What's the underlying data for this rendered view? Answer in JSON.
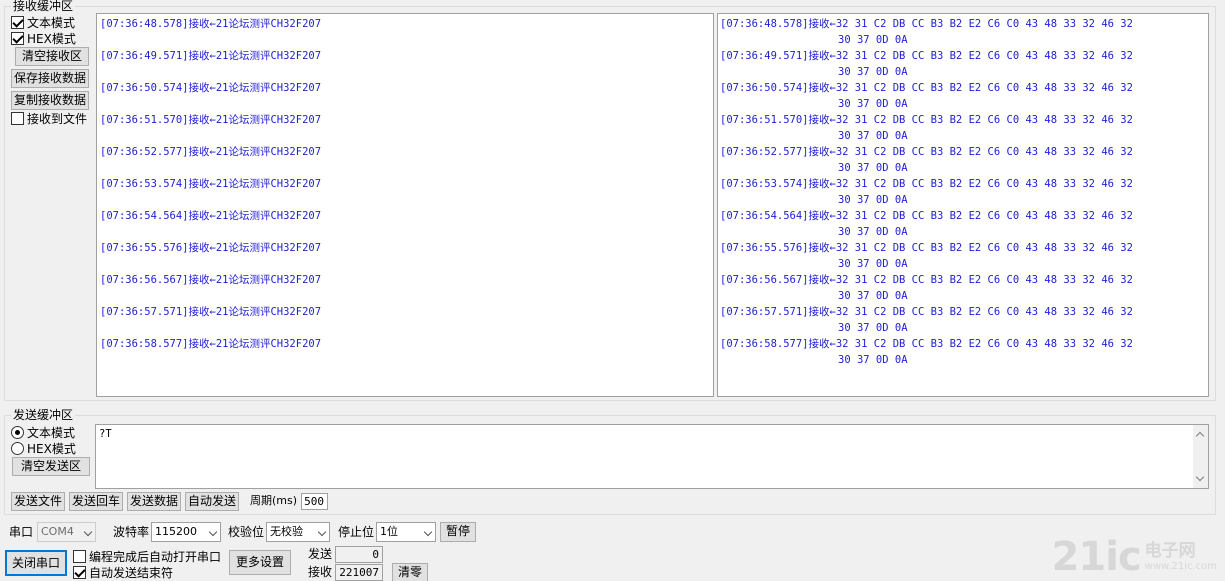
{
  "receive": {
    "group_title": "接收缓冲区",
    "text_mode_label": "文本模式",
    "text_mode_checked": true,
    "hex_mode_label": "HEX模式",
    "hex_mode_checked": true,
    "clear_button": "清空接收区",
    "save_button": "保存接收数据",
    "copy_button": "复制接收数据",
    "to_file_label": "接收到文件",
    "to_file_checked": false,
    "text_lines": [
      "[07:36:48.578]接收←21论坛测评CH32F207",
      "[07:36:49.571]接收←21论坛测评CH32F207",
      "[07:36:50.574]接收←21论坛测评CH32F207",
      "[07:36:51.570]接收←21论坛测评CH32F207",
      "[07:36:52.577]接收←21论坛测评CH32F207",
      "[07:36:53.574]接收←21论坛测评CH32F207",
      "[07:36:54.564]接收←21论坛测评CH32F207",
      "[07:36:55.576]接收←21论坛测评CH32F207",
      "[07:36:56.567]接收←21论坛测评CH32F207",
      "[07:36:57.571]接收←21论坛测评CH32F207",
      "[07:36:58.577]接收←21论坛测评CH32F207"
    ],
    "hex_lines": [
      {
        "line1": "[07:36:48.578]接收←32 31 C2 DB CC B3 B2 E2 C6 C0 43 48 33 32 46 32",
        "line2": "30 37 0D 0A"
      },
      {
        "line1": "[07:36:49.571]接收←32 31 C2 DB CC B3 B2 E2 C6 C0 43 48 33 32 46 32",
        "line2": "30 37 0D 0A"
      },
      {
        "line1": "[07:36:50.574]接收←32 31 C2 DB CC B3 B2 E2 C6 C0 43 48 33 32 46 32",
        "line2": "30 37 0D 0A"
      },
      {
        "line1": "[07:36:51.570]接收←32 31 C2 DB CC B3 B2 E2 C6 C0 43 48 33 32 46 32",
        "line2": "30 37 0D 0A"
      },
      {
        "line1": "[07:36:52.577]接收←32 31 C2 DB CC B3 B2 E2 C6 C0 43 48 33 32 46 32",
        "line2": "30 37 0D 0A"
      },
      {
        "line1": "[07:36:53.574]接收←32 31 C2 DB CC B3 B2 E2 C6 C0 43 48 33 32 46 32",
        "line2": "30 37 0D 0A"
      },
      {
        "line1": "[07:36:54.564]接收←32 31 C2 DB CC B3 B2 E2 C6 C0 43 48 33 32 46 32",
        "line2": "30 37 0D 0A"
      },
      {
        "line1": "[07:36:55.576]接收←32 31 C2 DB CC B3 B2 E2 C6 C0 43 48 33 32 46 32",
        "line2": "30 37 0D 0A"
      },
      {
        "line1": "[07:36:56.567]接收←32 31 C2 DB CC B3 B2 E2 C6 C0 43 48 33 32 46 32",
        "line2": "30 37 0D 0A"
      },
      {
        "line1": "[07:36:57.571]接收←32 31 C2 DB CC B3 B2 E2 C6 C0 43 48 33 32 46 32",
        "line2": "30 37 0D 0A"
      },
      {
        "line1": "[07:36:58.577]接收←32 31 C2 DB CC B3 B2 E2 C6 C0 43 48 33 32 46 32",
        "line2": "30 37 0D 0A"
      }
    ]
  },
  "send": {
    "group_title": "发送缓冲区",
    "text_mode_label": "文本模式",
    "text_mode_selected": true,
    "hex_mode_label": "HEX模式",
    "clear_button": "清空发送区",
    "content": "?T",
    "send_file_button": "发送文件",
    "send_return_button": "发送回车",
    "send_data_button": "发送数据",
    "auto_send_button": "自动发送",
    "period_label": "周期(ms)",
    "period_value": "500"
  },
  "port": {
    "port_label": "串口",
    "port_value": "COM4",
    "baud_label": "波特率",
    "baud_value": "115200",
    "parity_label": "校验位",
    "parity_value": "无校验",
    "stop_label": "停止位",
    "stop_value": "1位",
    "pause_button": "暂停",
    "close_button": "关闭串口",
    "auto_open_label": "编程完成后自动打开串口",
    "auto_open_checked": false,
    "auto_end_label": "自动发送结束符",
    "auto_end_checked": true,
    "more_settings_button": "更多设置",
    "sent_label": "发送",
    "sent_value": "0",
    "recv_label": "接收",
    "recv_value": "221007",
    "clear_count_button": "清零"
  },
  "watermark": {
    "main": "21ic",
    "cn": "电子网",
    "en": "www.21ic.com"
  }
}
